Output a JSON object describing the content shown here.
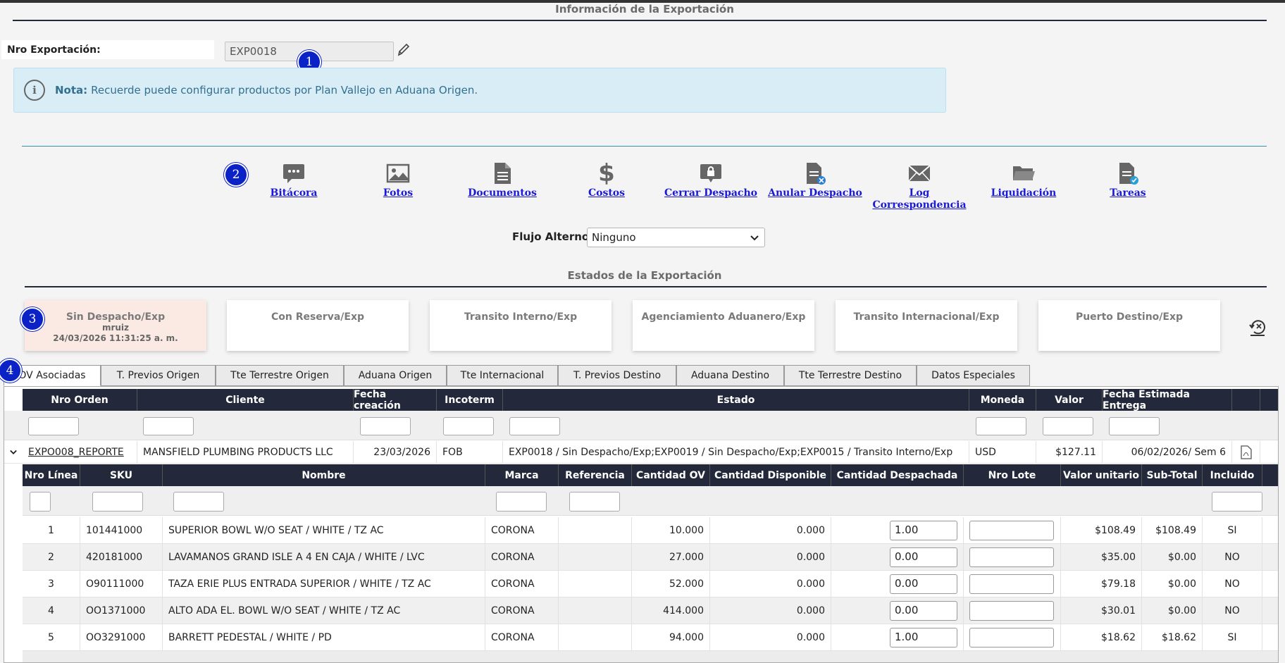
{
  "header": {
    "title": "Información de la Exportación"
  },
  "export": {
    "label": "Nro Exportación:",
    "value": "EXP0018"
  },
  "badges": [
    "1",
    "2",
    "3",
    "4"
  ],
  "note": {
    "prefix": "Nota:",
    "text": "Recuerde puede configurar productos por Plan Vallejo en Aduana Origen."
  },
  "actions": [
    {
      "label": "Bitácora",
      "icon": "chat-icon"
    },
    {
      "label": "Fotos",
      "icon": "image-icon"
    },
    {
      "label": "Documentos",
      "icon": "document-icon"
    },
    {
      "label": "Costos",
      "icon": "dollar-icon"
    },
    {
      "label": "Cerrar Despacho",
      "icon": "lock-chat-icon"
    },
    {
      "label": "Anular Despacho",
      "icon": "document-cancel-icon"
    },
    {
      "label": "Log Correspondencia",
      "icon": "envelope-icon"
    },
    {
      "label": "Liquidación",
      "icon": "folder-icon"
    },
    {
      "label": "Tareas",
      "icon": "task-document-icon"
    }
  ],
  "flujo": {
    "label": "Flujo Alterno:",
    "selected": "Ninguno"
  },
  "states": {
    "title": "Estados de la Exportación",
    "items": [
      {
        "name": "Sin Despacho/Exp",
        "user": "mruiz",
        "date": "24/03/2026 11:31:25 a. m."
      },
      {
        "name": "Con Reserva/Exp"
      },
      {
        "name": "Transito Interno/Exp"
      },
      {
        "name": "Agenciamiento Aduanero/Exp"
      },
      {
        "name": "Transito Internacional/Exp"
      },
      {
        "name": "Puerto Destino/Exp"
      }
    ]
  },
  "tabs": [
    "OV Asociadas",
    "T. Previos Origen",
    "Tte Terrestre Origen",
    "Aduana Origen",
    "Tte Internacional",
    "T. Previos Destino",
    "Aduana Destino",
    "Tte Terrestre Destino",
    "Datos Especiales"
  ],
  "orders": {
    "headers": [
      "Nro Orden",
      "Cliente",
      "Fecha creación",
      "Incoterm",
      "Estado",
      "Moneda",
      "Valor",
      "Fecha Estimada Entrega"
    ],
    "row": {
      "nro_orden": "EXPO008_REPORTE",
      "cliente": "MANSFIELD PLUMBING PRODUCTS LLC",
      "fecha": "23/03/2026",
      "incoterm": "FOB",
      "estado": "EXP0018 / Sin Despacho/Exp;EXP0019 / Sin Despacho/Exp;EXP0015 / Transito Interno/Exp",
      "moneda": "USD",
      "valor": "$127.11",
      "fecha_entrega": "06/02/2026/ Sem 6"
    }
  },
  "lines": {
    "headers": [
      "Nro Línea",
      "SKU",
      "Nombre",
      "Marca",
      "Referencia",
      "Cantidad OV",
      "Cantidad Disponible",
      "Cantidad Despachada",
      "Nro Lote",
      "Valor unitario",
      "Sub-Total",
      "Incluido"
    ],
    "rows": [
      {
        "linea": "1",
        "sku": "101441000",
        "nombre": "SUPERIOR BOWL W/O SEAT / WHITE / TZ AC",
        "marca": "CORONA",
        "ref": "",
        "cant_ov": "10.000",
        "cant_disp": "0.000",
        "cant_desp": "1.00",
        "lote": "",
        "valor": "$108.49",
        "subtotal": "$108.49",
        "incluido": "SI"
      },
      {
        "linea": "2",
        "sku": "420181000",
        "nombre": "LAVAMANOS GRAND ISLE A 4 EN CAJA / WHITE / LVC",
        "marca": "CORONA",
        "ref": "",
        "cant_ov": "27.000",
        "cant_disp": "0.000",
        "cant_desp": "0.00",
        "lote": "",
        "valor": "$35.00",
        "subtotal": "$0.00",
        "incluido": "NO"
      },
      {
        "linea": "3",
        "sku": "O90111000",
        "nombre": "TAZA ERIE PLUS ENTRADA SUPERIOR / WHITE / TZ AC",
        "marca": "CORONA",
        "ref": "",
        "cant_ov": "52.000",
        "cant_disp": "0.000",
        "cant_desp": "0.00",
        "lote": "",
        "valor": "$79.18",
        "subtotal": "$0.00",
        "incluido": "NO"
      },
      {
        "linea": "4",
        "sku": "OO1371000",
        "nombre": "ALTO ADA EL. BOWL W/O SEAT / WHITE / TZ AC",
        "marca": "CORONA",
        "ref": "",
        "cant_ov": "414.000",
        "cant_disp": "0.000",
        "cant_desp": "0.00",
        "lote": "",
        "valor": "$30.01",
        "subtotal": "$0.00",
        "incluido": "NO"
      },
      {
        "linea": "5",
        "sku": "OO3291000",
        "nombre": "BARRETT PEDESTAL / WHITE / PD",
        "marca": "CORONA",
        "ref": "",
        "cant_ov": "94.000",
        "cant_disp": "0.000",
        "cant_desp": "1.00",
        "lote": "",
        "valor": "$18.62",
        "subtotal": "$18.62",
        "incluido": "SI"
      }
    ]
  },
  "colors": {
    "header_dark": "#23283a",
    "link": "#1a1ad6",
    "badge": "#0b22c7",
    "note_bg": "#d9edf7",
    "active_state": "#fbeae3"
  }
}
